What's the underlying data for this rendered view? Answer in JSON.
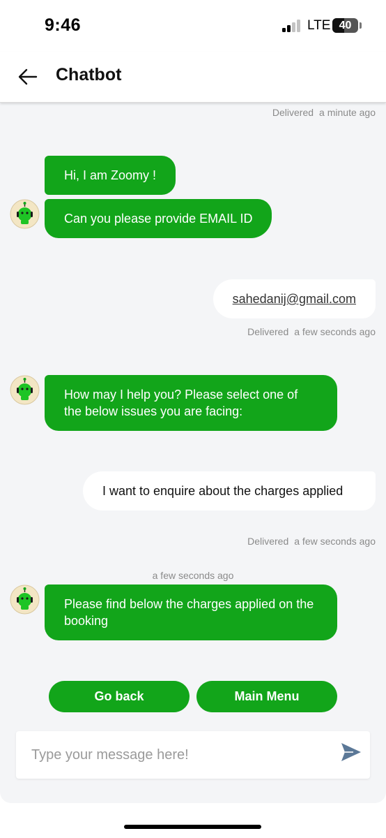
{
  "status_bar": {
    "time": "9:46",
    "network": "LTE",
    "battery": "40"
  },
  "header": {
    "title": "Chatbot",
    "back_icon": "arrow-left-icon"
  },
  "messages": [
    {
      "id": "meta-0",
      "text": "Delivered",
      "time": "a minute ago"
    },
    {
      "id": "bot-1",
      "sender": "bot",
      "text": "Hi, I am Zoomy !"
    },
    {
      "id": "bot-2",
      "sender": "bot",
      "text": "Can you please provide EMAIL ID"
    },
    {
      "id": "user-1",
      "sender": "user",
      "text": "sahedanij@gmail.com",
      "status": "Delivered",
      "time": "a few seconds ago"
    },
    {
      "id": "bot-3",
      "sender": "bot",
      "text": "How may I help you? Please select one of the below issues you are facing:"
    },
    {
      "id": "user-2",
      "sender": "user",
      "text": "I want to enquire about the charges applied",
      "status": "Delivered",
      "time": "a few seconds ago"
    },
    {
      "id": "bot-4",
      "sender": "bot",
      "time": "a few seconds ago",
      "text": "Please find below the charges applied on the booking"
    }
  ],
  "quick_actions": [
    {
      "label": "Go back"
    },
    {
      "label": "Main Menu"
    }
  ],
  "composer": {
    "placeholder": "Type your message here!",
    "send_icon": "send-icon"
  },
  "colors": {
    "bot_bubble": "#12a51a",
    "chat_background": "#f4f5f7",
    "send_icon": "#5b7897"
  }
}
